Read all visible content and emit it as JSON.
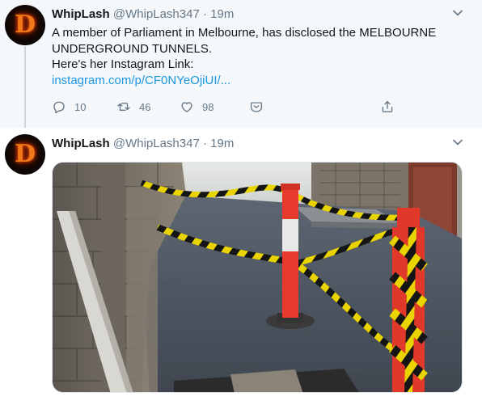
{
  "tweets": [
    {
      "author_name": "WhipLash",
      "author_handle": "@WhipLash347",
      "separator": "·",
      "time": "19m",
      "avatar_letter": "D",
      "text_lines": [
        "A member of Parliament in Melbourne, has disclosed the MELBOURNE",
        "UNDERGROUND TUNNELS.",
        "Here's her Instagram Link:"
      ],
      "link_text": "instagram.com/p/CF0NYeOjiUI/...",
      "counts": {
        "replies": "10",
        "retweets": "46",
        "likes": "98"
      }
    },
    {
      "author_name": "WhipLash",
      "author_handle": "@WhipLash347",
      "separator": "·",
      "time": "19m",
      "avatar_letter": "D",
      "media_description_icon": "photo"
    }
  ],
  "icons": {
    "reply": "reply-icon",
    "retweet": "retweet-icon",
    "like": "heart-icon",
    "dm": "direct-message-icon",
    "share": "share-icon",
    "more": "chevron-down-icon"
  },
  "colors": {
    "link": "#1b95e0",
    "muted": "#657786",
    "highlight_bg": "#f5f8fa",
    "thread_line": "#cdd6dd"
  }
}
